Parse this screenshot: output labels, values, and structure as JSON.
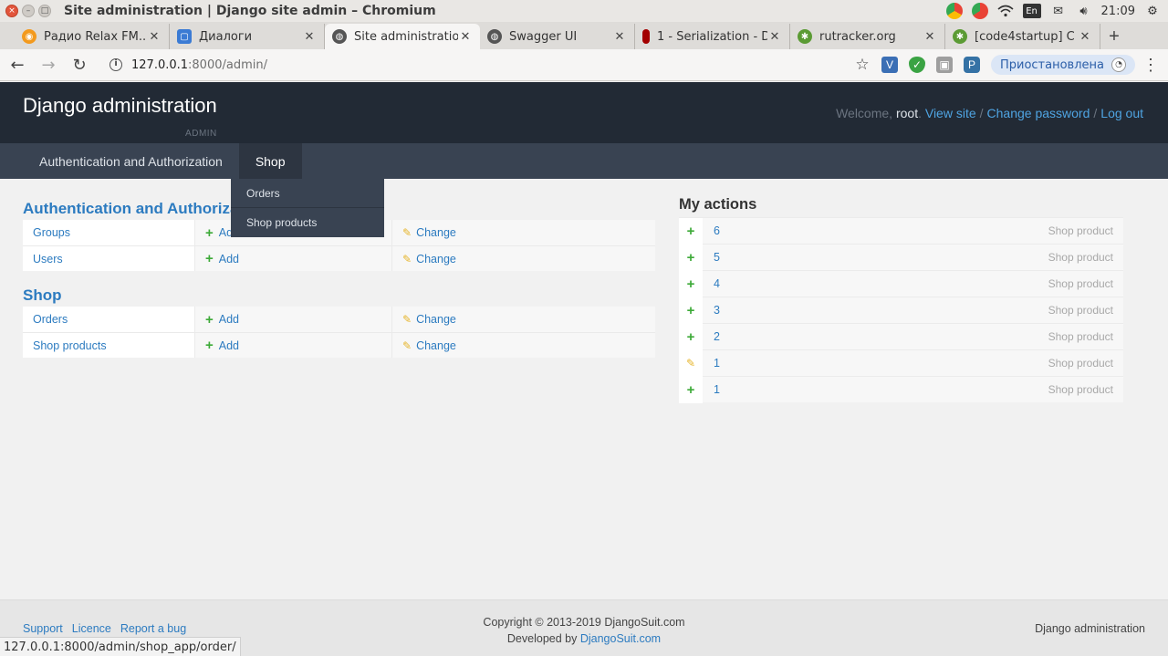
{
  "os": {
    "window_title": "Site administration | Django site admin – Chromium",
    "clock": "21:09",
    "keyboard_layout": "En"
  },
  "browser": {
    "tabs": [
      {
        "label": "Радио Relax FM...",
        "icon": "radio-icon",
        "color": "#f39a1e"
      },
      {
        "label": "Диалоги",
        "icon": "chat-icon",
        "color": "#3b7bd4"
      },
      {
        "label": "Site administratio",
        "icon": "globe-icon",
        "color": "#555555",
        "active": true
      },
      {
        "label": "Swagger UI",
        "icon": "globe-icon",
        "color": "#555555"
      },
      {
        "label": "1 - Serialization - D",
        "icon": "drf-icon",
        "color": "#a30000"
      },
      {
        "label": "rutracker.org",
        "icon": "rutracker-icon",
        "color": "#5b9b34"
      },
      {
        "label": "[code4startup] C",
        "icon": "rutracker-icon",
        "color": "#5b9b34"
      }
    ],
    "url_host": "127.0.0.1",
    "url_rest": ":8000/admin/",
    "sync_status": "Приостановлена"
  },
  "header": {
    "brand": "Django administration",
    "brand_sub": "ADMIN",
    "welcome": "Welcome,",
    "username": "root",
    "links": [
      "View site",
      "Change password",
      "Log out"
    ]
  },
  "nav": {
    "items": [
      "Authentication and Authorization",
      "Shop"
    ],
    "dropdown": [
      "Orders",
      "Shop products"
    ]
  },
  "modules": [
    {
      "title": "Authentication and Authorization",
      "rows": [
        {
          "name": "Groups",
          "add": "Add",
          "change": "Change"
        },
        {
          "name": "Users",
          "add": "Add",
          "change": "Change"
        }
      ]
    },
    {
      "title": "Shop",
      "rows": [
        {
          "name": "Orders",
          "add": "Add",
          "change": "Change"
        },
        {
          "name": "Shop products",
          "add": "Add",
          "change": "Change"
        }
      ]
    }
  ],
  "actions": {
    "title": "My actions",
    "items": [
      {
        "kind": "add",
        "id": "6",
        "type": "Shop product"
      },
      {
        "kind": "add",
        "id": "5",
        "type": "Shop product"
      },
      {
        "kind": "add",
        "id": "4",
        "type": "Shop product"
      },
      {
        "kind": "add",
        "id": "3",
        "type": "Shop product"
      },
      {
        "kind": "add",
        "id": "2",
        "type": "Shop product"
      },
      {
        "kind": "change",
        "id": "1",
        "type": "Shop product"
      },
      {
        "kind": "add",
        "id": "1",
        "type": "Shop product"
      }
    ]
  },
  "footer": {
    "links": [
      "Support",
      "Licence",
      "Report a bug"
    ],
    "copyright": "Copyright © 2013-2019 DjangoSuit.com",
    "developed_prefix": "Developed by",
    "developed_link": "DjangoSuit.com",
    "right": "Django administration"
  },
  "status_url": "127.0.0.1:8000/admin/shop_app/order/"
}
